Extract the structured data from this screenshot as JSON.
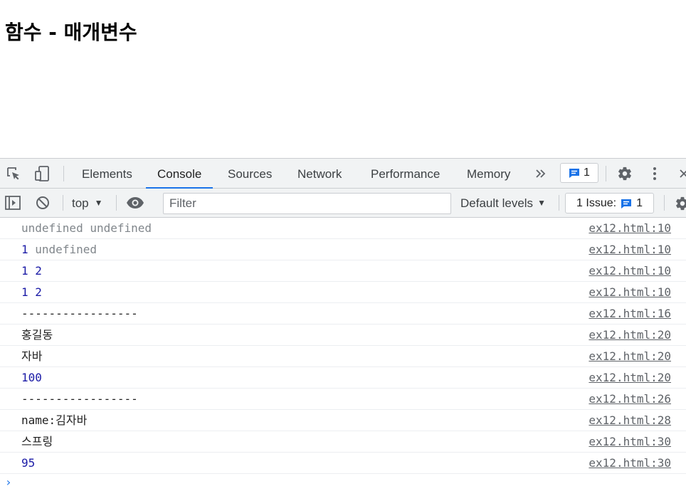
{
  "page": {
    "title": "함수 - 매개변수"
  },
  "devtools": {
    "tabs": [
      {
        "label": "Elements"
      },
      {
        "label": "Console",
        "active": true
      },
      {
        "label": "Sources"
      },
      {
        "label": "Network"
      },
      {
        "label": "Performance"
      },
      {
        "label": "Memory"
      }
    ],
    "more_tabs_icon": "chevron-double-right-icon",
    "message_badge": {
      "count": "1"
    },
    "accent_color": "#1a73e8"
  },
  "console_toolbar": {
    "context": "top",
    "filter_placeholder": "Filter",
    "levels": "Default levels",
    "issues_label": "1 Issue:",
    "issues_count": "1"
  },
  "console": {
    "rows": [
      {
        "parts": [
          {
            "text": "undefined undefined",
            "kind": "undef"
          }
        ],
        "source": "ex12.html:10"
      },
      {
        "parts": [
          {
            "text": "1",
            "kind": "num"
          },
          {
            "text": " "
          },
          {
            "text": "undefined",
            "kind": "undef"
          }
        ],
        "source": "ex12.html:10"
      },
      {
        "parts": [
          {
            "text": "1 2",
            "kind": "num"
          }
        ],
        "source": "ex12.html:10"
      },
      {
        "parts": [
          {
            "text": "1 2",
            "kind": "num"
          }
        ],
        "source": "ex12.html:10"
      },
      {
        "parts": [
          {
            "text": "-----------------"
          }
        ],
        "source": "ex12.html:16"
      },
      {
        "parts": [
          {
            "text": "홍길동"
          }
        ],
        "source": "ex12.html:20"
      },
      {
        "parts": [
          {
            "text": "자바"
          }
        ],
        "source": "ex12.html:20"
      },
      {
        "parts": [
          {
            "text": "100",
            "kind": "num"
          }
        ],
        "source": "ex12.html:20"
      },
      {
        "parts": [
          {
            "text": "-----------------"
          }
        ],
        "source": "ex12.html:26"
      },
      {
        "parts": [
          {
            "text": "name:김자바"
          }
        ],
        "source": "ex12.html:28"
      },
      {
        "parts": [
          {
            "text": "스프링"
          }
        ],
        "source": "ex12.html:30"
      },
      {
        "parts": [
          {
            "text": "95",
            "kind": "num"
          }
        ],
        "source": "ex12.html:30"
      }
    ],
    "prompt": "›"
  }
}
